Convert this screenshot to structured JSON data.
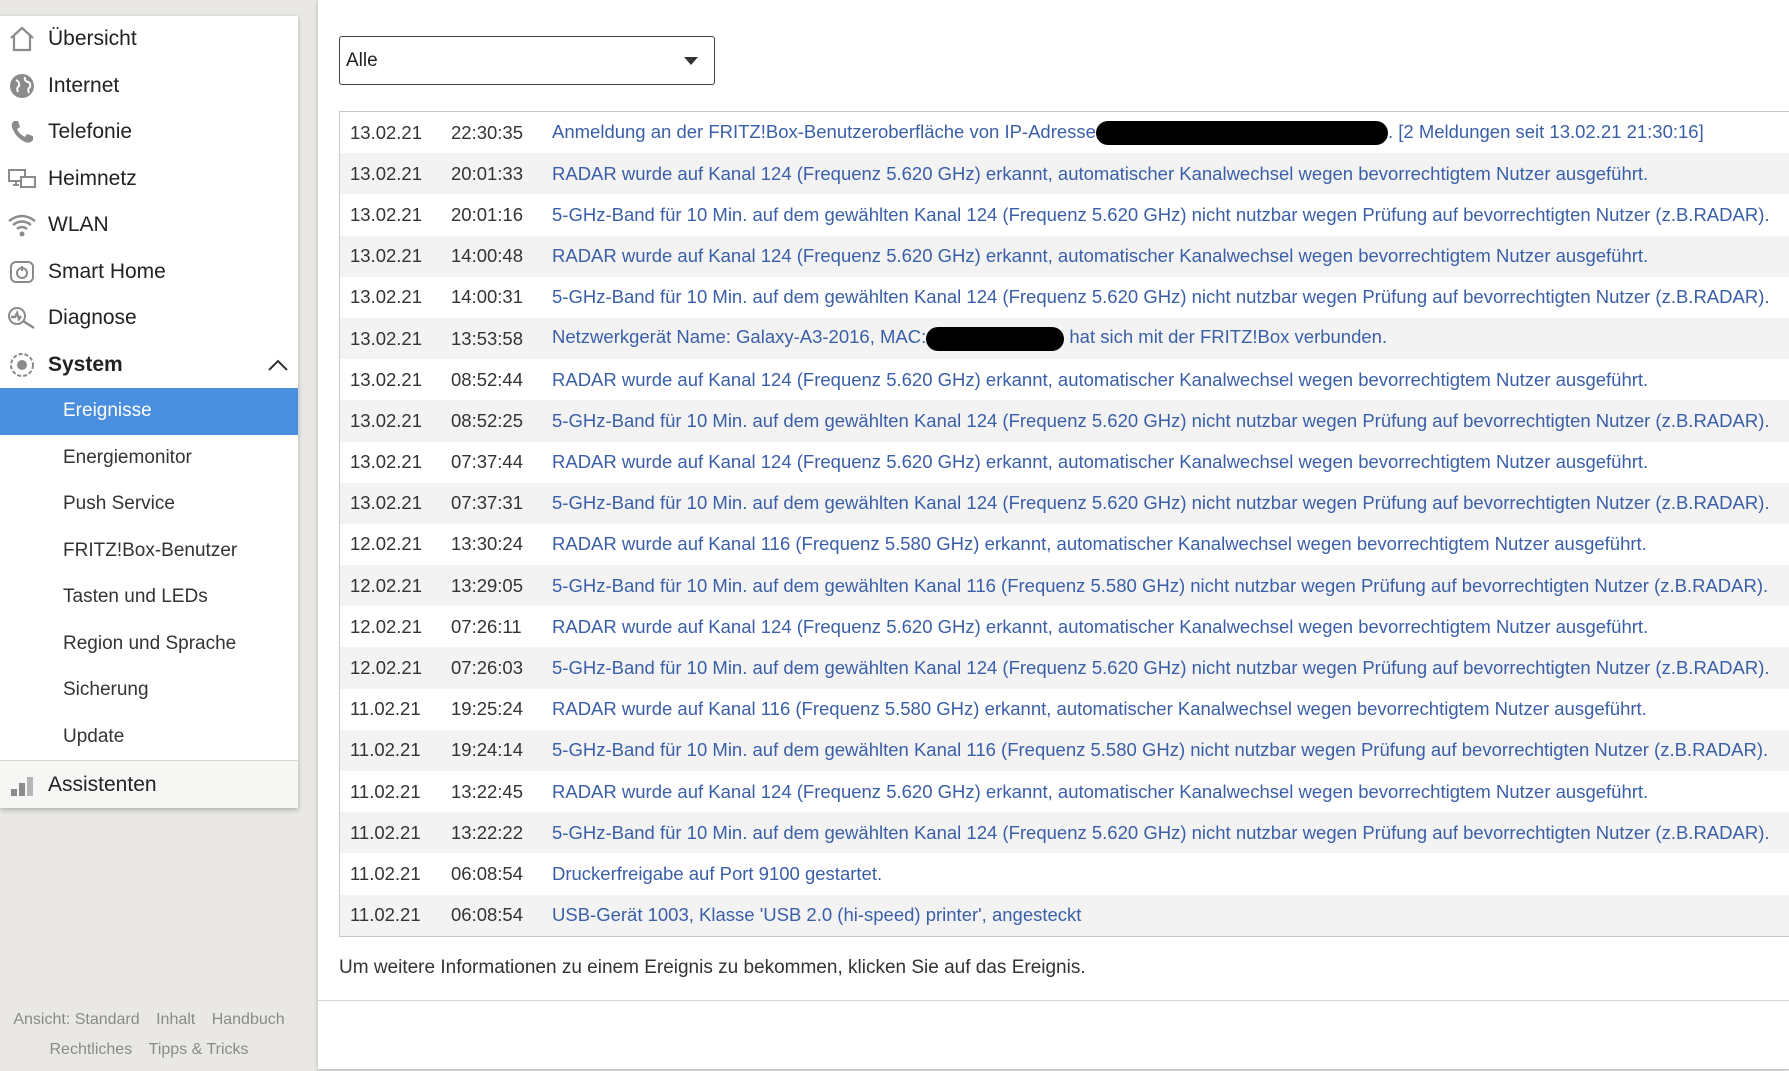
{
  "nav": {
    "items": [
      {
        "label": "Übersicht",
        "icon": "home-icon"
      },
      {
        "label": "Internet",
        "icon": "globe-icon"
      },
      {
        "label": "Telefonie",
        "icon": "phone-icon"
      },
      {
        "label": "Heimnetz",
        "icon": "network-icon"
      },
      {
        "label": "WLAN",
        "icon": "wifi-icon"
      },
      {
        "label": "Smart Home",
        "icon": "smart-home-icon"
      },
      {
        "label": "Diagnose",
        "icon": "diagnose-icon"
      },
      {
        "label": "System",
        "icon": "system-icon"
      }
    ],
    "system_sub": [
      {
        "label": "Ereignisse",
        "active": true
      },
      {
        "label": "Energiemonitor"
      },
      {
        "label": "Push Service"
      },
      {
        "label": "FRITZ!Box-Benutzer"
      },
      {
        "label": "Tasten und LEDs"
      },
      {
        "label": "Region und Sprache"
      },
      {
        "label": "Sicherung"
      },
      {
        "label": "Update"
      }
    ],
    "assistants": {
      "label": "Assistenten",
      "icon": "assistants-icon"
    }
  },
  "footer": {
    "view": "Ansicht: Standard",
    "content": "Inhalt",
    "manual": "Handbuch",
    "legal": "Rechtliches",
    "tips": "Tipps & Tricks"
  },
  "filter": {
    "selected": "Alle"
  },
  "events": [
    {
      "date": "13.02.21",
      "time": "22:30:35",
      "msg_pre": "Anmeldung an der FRITZ!Box-Benutzeroberfläche von IP-Adresse",
      "msg_post": ". [2 Meldungen seit 13.02.21 21:30:16]",
      "redacted": true
    },
    {
      "date": "13.02.21",
      "time": "20:01:33",
      "msg": "RADAR wurde auf Kanal 124 (Frequenz 5.620 GHz) erkannt, automatischer Kanalwechsel wegen bevorrechtigtem Nutzer ausgeführt."
    },
    {
      "date": "13.02.21",
      "time": "20:01:16",
      "msg": "5-GHz-Band für 10 Min. auf dem gewählten Kanal 124 (Frequenz 5.620 GHz) nicht nutzbar wegen Prüfung auf bevorrechtigten Nutzer (z.B.RADAR)."
    },
    {
      "date": "13.02.21",
      "time": "14:00:48",
      "msg": "RADAR wurde auf Kanal 124 (Frequenz 5.620 GHz) erkannt, automatischer Kanalwechsel wegen bevorrechtigtem Nutzer ausgeführt."
    },
    {
      "date": "13.02.21",
      "time": "14:00:31",
      "msg": "5-GHz-Band für 10 Min. auf dem gewählten Kanal 124 (Frequenz 5.620 GHz) nicht nutzbar wegen Prüfung auf bevorrechtigten Nutzer (z.B.RADAR)."
    },
    {
      "date": "13.02.21",
      "time": "13:53:58",
      "msg_pre": "Netzwerkgerät Name: Galaxy-A3-2016, MAC:",
      "msg_post": " hat sich mit der FRITZ!Box verbunden.",
      "redacted": true
    },
    {
      "date": "13.02.21",
      "time": "08:52:44",
      "msg": "RADAR wurde auf Kanal 124 (Frequenz 5.620 GHz) erkannt, automatischer Kanalwechsel wegen bevorrechtigtem Nutzer ausgeführt."
    },
    {
      "date": "13.02.21",
      "time": "08:52:25",
      "msg": "5-GHz-Band für 10 Min. auf dem gewählten Kanal 124 (Frequenz 5.620 GHz) nicht nutzbar wegen Prüfung auf bevorrechtigten Nutzer (z.B.RADAR)."
    },
    {
      "date": "13.02.21",
      "time": "07:37:44",
      "msg": "RADAR wurde auf Kanal 124 (Frequenz 5.620 GHz) erkannt, automatischer Kanalwechsel wegen bevorrechtigtem Nutzer ausgeführt."
    },
    {
      "date": "13.02.21",
      "time": "07:37:31",
      "msg": "5-GHz-Band für 10 Min. auf dem gewählten Kanal 124 (Frequenz 5.620 GHz) nicht nutzbar wegen Prüfung auf bevorrechtigten Nutzer (z.B.RADAR)."
    },
    {
      "date": "12.02.21",
      "time": "13:30:24",
      "msg": "RADAR wurde auf Kanal 116 (Frequenz 5.580 GHz) erkannt, automatischer Kanalwechsel wegen bevorrechtigtem Nutzer ausgeführt."
    },
    {
      "date": "12.02.21",
      "time": "13:29:05",
      "msg": "5-GHz-Band für 10 Min. auf dem gewählten Kanal 116 (Frequenz 5.580 GHz) nicht nutzbar wegen Prüfung auf bevorrechtigten Nutzer (z.B.RADAR)."
    },
    {
      "date": "12.02.21",
      "time": "07:26:11",
      "msg": "RADAR wurde auf Kanal 124 (Frequenz 5.620 GHz) erkannt, automatischer Kanalwechsel wegen bevorrechtigtem Nutzer ausgeführt."
    },
    {
      "date": "12.02.21",
      "time": "07:26:03",
      "msg": "5-GHz-Band für 10 Min. auf dem gewählten Kanal 124 (Frequenz 5.620 GHz) nicht nutzbar wegen Prüfung auf bevorrechtigten Nutzer (z.B.RADAR)."
    },
    {
      "date": "11.02.21",
      "time": "19:25:24",
      "msg": "RADAR wurde auf Kanal 116 (Frequenz 5.580 GHz) erkannt, automatischer Kanalwechsel wegen bevorrechtigtem Nutzer ausgeführt."
    },
    {
      "date": "11.02.21",
      "time": "19:24:14",
      "msg": "5-GHz-Band für 10 Min. auf dem gewählten Kanal 116 (Frequenz 5.580 GHz) nicht nutzbar wegen Prüfung auf bevorrechtigten Nutzer (z.B.RADAR)."
    },
    {
      "date": "11.02.21",
      "time": "13:22:45",
      "msg": "RADAR wurde auf Kanal 124 (Frequenz 5.620 GHz) erkannt, automatischer Kanalwechsel wegen bevorrechtigtem Nutzer ausgeführt."
    },
    {
      "date": "11.02.21",
      "time": "13:22:22",
      "msg": "5-GHz-Band für 10 Min. auf dem gewählten Kanal 124 (Frequenz 5.620 GHz) nicht nutzbar wegen Prüfung auf bevorrechtigten Nutzer (z.B.RADAR)."
    },
    {
      "date": "11.02.21",
      "time": "06:08:54",
      "msg": "Druckerfreigabe auf Port 9100 gestartet."
    },
    {
      "date": "11.02.21",
      "time": "06:08:54",
      "msg": "USB-Gerät 1003, Klasse 'USB 2.0 (hi-speed) printer', angesteckt"
    }
  ],
  "hint": "Um weitere Informationen zu einem Ereignis zu bekommen, klicken Sie auf das Ereignis.",
  "colors": {
    "accent": "#4a8ee0",
    "link": "#3a5fa8",
    "background": "#e9e8e4"
  }
}
